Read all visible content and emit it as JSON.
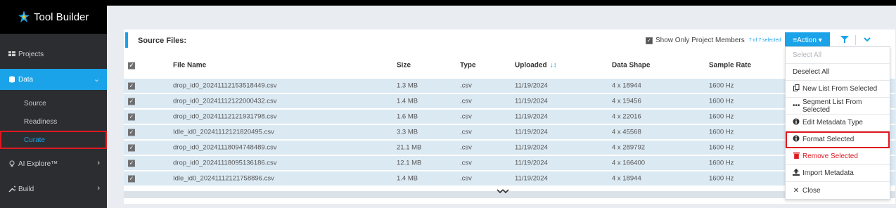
{
  "app": {
    "title": "Tool Builder"
  },
  "sidebar": {
    "items": [
      {
        "label": "Projects",
        "icon": "grid-icon"
      },
      {
        "label": "Data",
        "icon": "database-icon",
        "active": true
      },
      {
        "label": "AI Explore™",
        "icon": "bulb-icon"
      },
      {
        "label": "Build",
        "icon": "wrench-icon"
      }
    ],
    "sub_items": [
      {
        "label": "Source"
      },
      {
        "label": "Readiness"
      },
      {
        "label": "Curate",
        "active": true
      }
    ]
  },
  "panel": {
    "title": "Source Files:",
    "show_members_label": "Show Only Project Members",
    "selected_count": "7 of 7 selected",
    "action_label": "≡Action ▾"
  },
  "table": {
    "headers": [
      "",
      "File Name",
      "Size",
      "Type",
      "Uploaded",
      "Data Shape",
      "Sample Rate"
    ],
    "rows": [
      [
        "drop_id0_20241112153518449.csv",
        "1.3 MB",
        ".csv",
        "11/19/2024",
        "4 x 18944",
        "1600 Hz"
      ],
      [
        "drop_id0_20241112122000432.csv",
        "1.4 MB",
        ".csv",
        "11/19/2024",
        "4 x 19456",
        "1600 Hz"
      ],
      [
        "drop_id0_20241112121931798.csv",
        "1.6 MB",
        ".csv",
        "11/19/2024",
        "4 x 22016",
        "1600 Hz"
      ],
      [
        "Idle_id0_20241112121820495.csv",
        "3.3 MB",
        ".csv",
        "11/19/2024",
        "4 x 45568",
        "1600 Hz"
      ],
      [
        "drop_id0_20241118094748489.csv",
        "21.1 MB",
        ".csv",
        "11/19/2024",
        "4 x 289792",
        "1600 Hz"
      ],
      [
        "drop_id0_20241118095136186.csv",
        "12.1 MB",
        ".csv",
        "11/19/2024",
        "4 x 166400",
        "1600 Hz"
      ],
      [
        "Idle_id0_20241112121758896.csv",
        "1.4 MB",
        ".csv",
        "11/19/2024",
        "4 x 18944",
        "1600 Hz"
      ]
    ]
  },
  "dropdown": {
    "items": [
      {
        "label": "Select All",
        "icon": "",
        "state": "disabled"
      },
      {
        "label": "Deselect All",
        "icon": ""
      },
      {
        "label": "New List From Selected",
        "icon": "copy-icon"
      },
      {
        "label": "Segment List From Selected",
        "icon": "ellipsis-icon"
      },
      {
        "label": "Edit Metadata Type",
        "icon": "info-icon"
      },
      {
        "label": "Format Selected",
        "icon": "info-icon",
        "highlight": true
      },
      {
        "label": "Remove Selected",
        "icon": "trash-icon",
        "state": "danger"
      },
      {
        "label": "Import Metadata",
        "icon": "upload-icon"
      },
      {
        "label": "Close",
        "icon": "close-icon"
      }
    ]
  },
  "colors": {
    "accent": "#1aa3e8",
    "sidebar_bg": "#2b2d31",
    "highlight_border": "#e0191f",
    "row_selected": "#dbe9f3"
  }
}
